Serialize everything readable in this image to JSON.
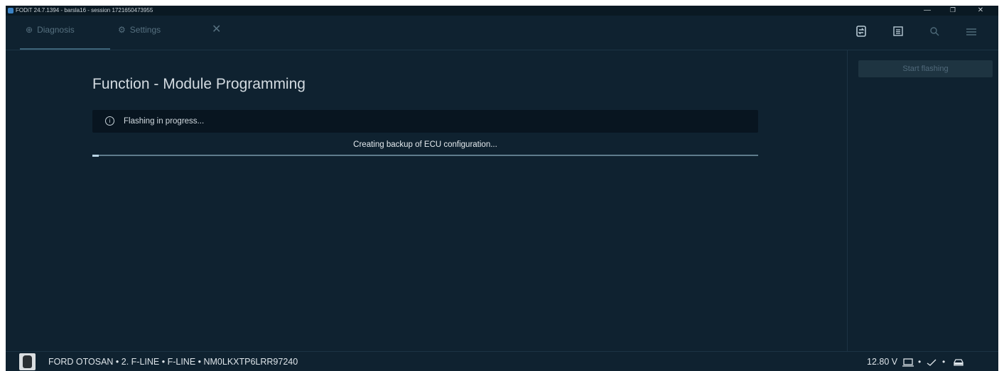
{
  "window": {
    "title": "FODiT 24.7.1394 - barsla16 - session 1721650473955",
    "controls": {
      "minimize": "—",
      "maximize": "❐",
      "close": "✕"
    }
  },
  "tabs": {
    "diagnosis": {
      "label": "Diagnosis",
      "icon": "diagnosis-icon"
    },
    "settings": {
      "label": "Settings",
      "icon": "gear-icon"
    },
    "close": "✕"
  },
  "toolbar": {
    "icons": [
      "swap-icon",
      "list-icon",
      "search-icon",
      "menu-icon"
    ]
  },
  "main": {
    "title": "Function - Module Programming",
    "banner": {
      "icon": "info-icon",
      "text": "Flashing in progress..."
    },
    "status": "Creating backup of ECU configuration...",
    "progress": 0.01
  },
  "side_panel": {
    "start_button": "Start flashing"
  },
  "statusbar": {
    "vehicle": "FORD OTOSAN • 2. F-LINE • F-LINE • NM0LKXTP6LRR97240",
    "voltage": "12.80 V",
    "separator": "•",
    "icons": [
      "laptop-icon",
      "check-icon",
      "car-icon"
    ]
  },
  "colors": {
    "background": "#0f2230",
    "banner": "#081520",
    "progress_fill": "#b8d4e4",
    "progress_track": "#5f7c8c",
    "button_disabled": "#1e3441"
  }
}
